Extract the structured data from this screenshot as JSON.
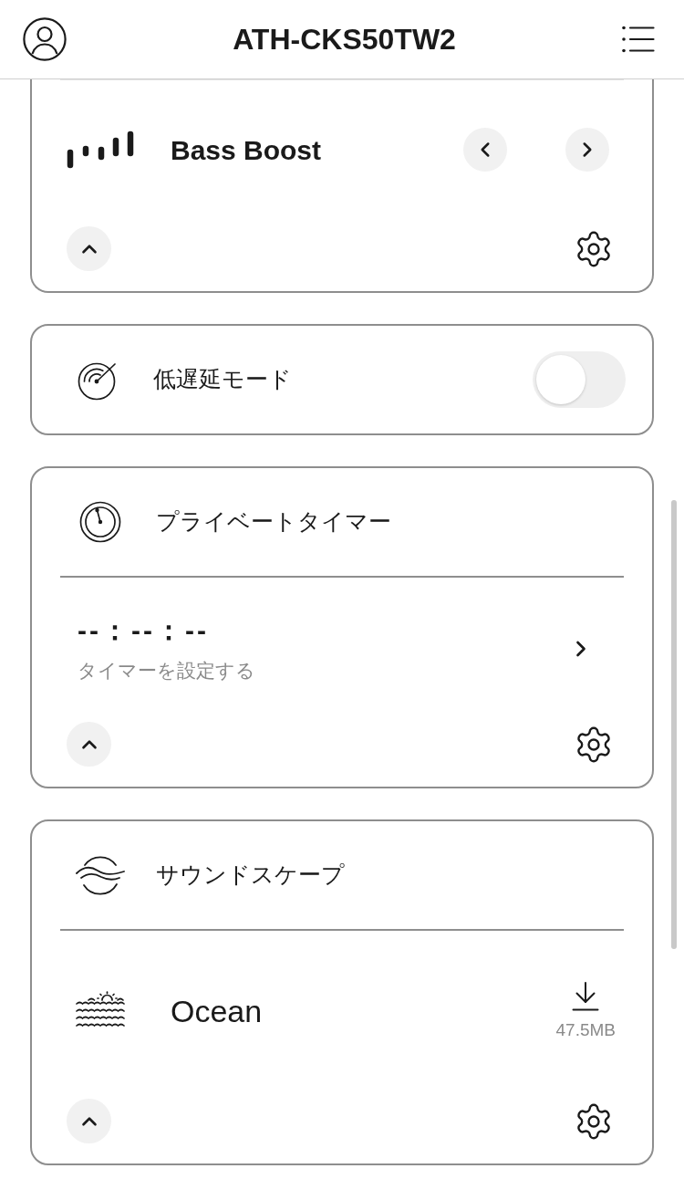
{
  "header": {
    "title": "ATH-CKS50TW2"
  },
  "cards": [
    {
      "kind": "preset",
      "preset": "Bass Boost",
      "expanded": true
    },
    {
      "kind": "toggle",
      "label": "低遅延モード",
      "on": false
    },
    {
      "kind": "timer",
      "title": "プライベートタイマー",
      "time": "--：--：--",
      "caption": "タイマーを設定する",
      "expanded": true
    },
    {
      "kind": "soundscape",
      "title": "サウンドスケープ",
      "track": "Ocean",
      "size": "47.5MB",
      "expanded": true
    }
  ]
}
